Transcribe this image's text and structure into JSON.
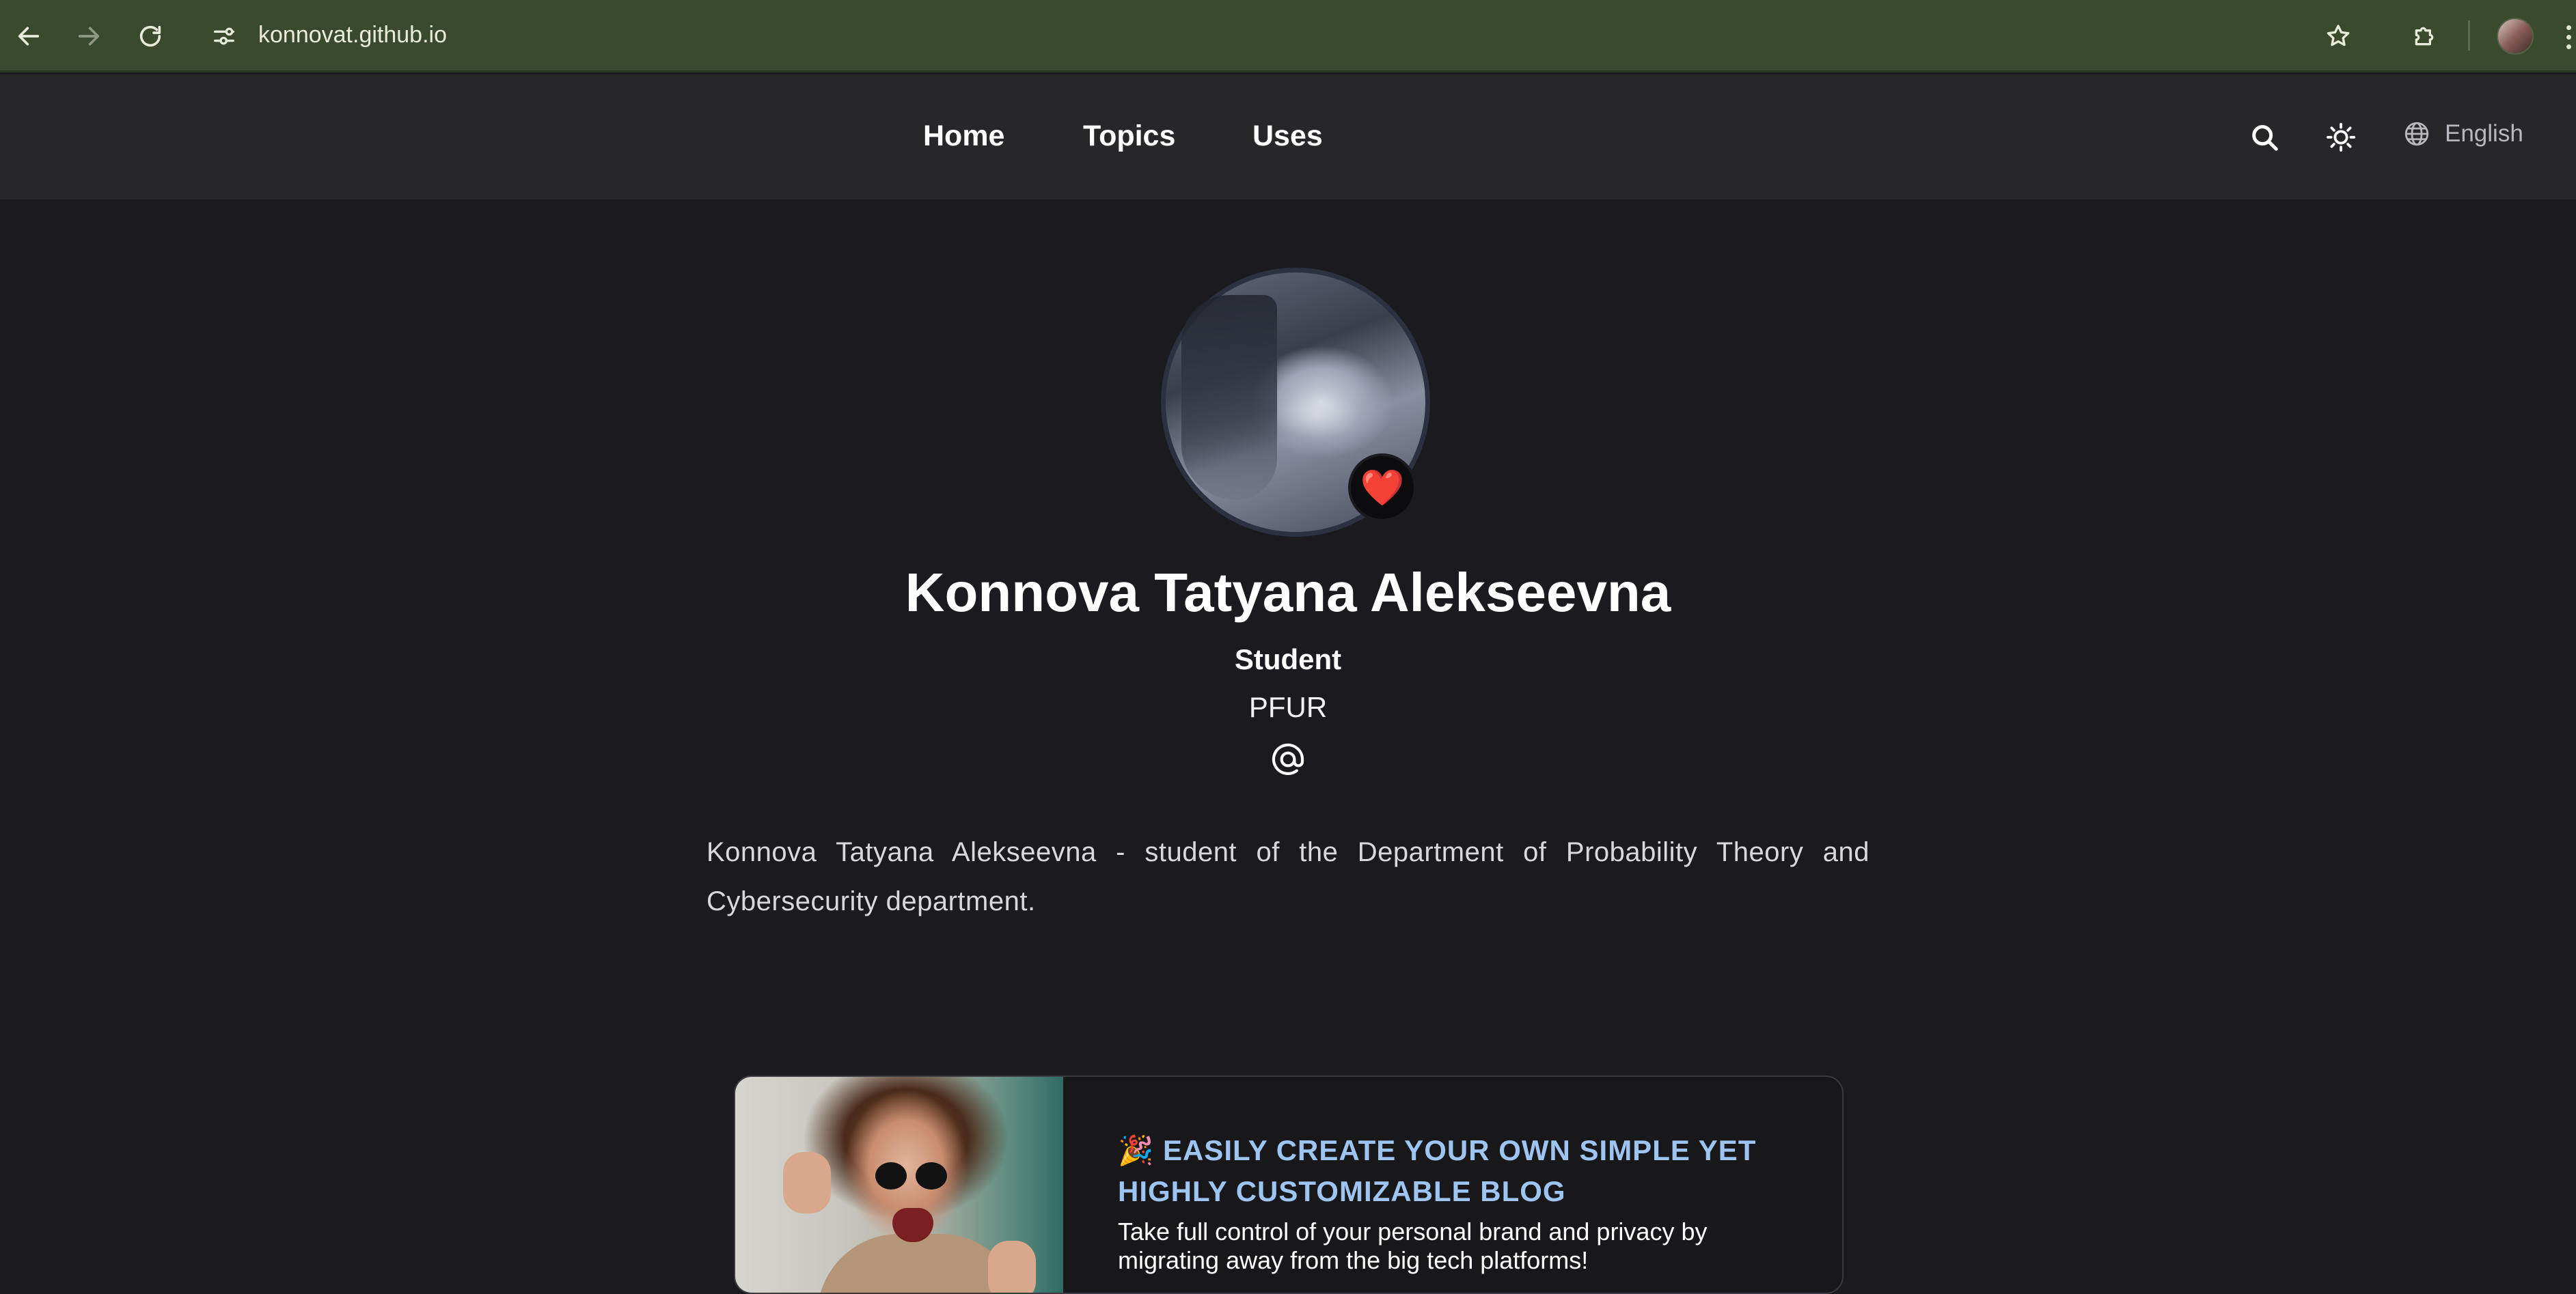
{
  "browser": {
    "url": "konnovat.github.io"
  },
  "nav": {
    "items": [
      {
        "label": "Home"
      },
      {
        "label": "Topics"
      },
      {
        "label": "Uses"
      }
    ],
    "language": "English"
  },
  "profile": {
    "name": "Konnova Tatyana Alekseevna",
    "role": "Student",
    "organization": "PFUR",
    "status_emoji": "❤️",
    "bio": "Konnova Tatyana Alekseevna - student of the Department of Probability Theory and Cybersecurity department."
  },
  "promo": {
    "title": "🎉 EASILY CREATE YOUR OWN SIMPLE YET HIGHLY CUSTOMIZABLE BLOG",
    "text": "Take full control of your personal brand and privacy by migrating away from the big tech platforms!"
  },
  "icons": {
    "back": "arrow-left-icon",
    "forward": "arrow-right-icon",
    "reload": "reload-icon",
    "site_info": "tune-icon",
    "bookmark": "star-icon",
    "extensions": "puzzle-icon",
    "search": "search-icon",
    "theme": "sun-icon",
    "language": "globe-icon",
    "email": "at-icon"
  },
  "colors": {
    "browser_bar": "#3a4a2c",
    "header_bg": "#27272a",
    "page_bg": "#1b1b1f",
    "promo_title": "#9ec5f2"
  }
}
